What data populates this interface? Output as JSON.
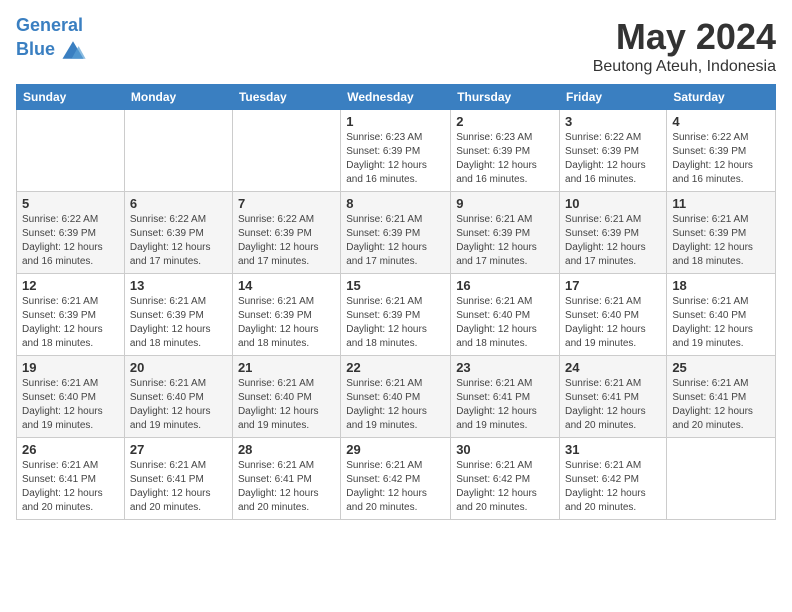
{
  "header": {
    "logo_line1": "General",
    "logo_line2": "Blue",
    "month_title": "May 2024",
    "location": "Beutong Ateuh, Indonesia"
  },
  "days_of_week": [
    "Sunday",
    "Monday",
    "Tuesday",
    "Wednesday",
    "Thursday",
    "Friday",
    "Saturday"
  ],
  "weeks": [
    [
      {
        "day": "",
        "info": ""
      },
      {
        "day": "",
        "info": ""
      },
      {
        "day": "",
        "info": ""
      },
      {
        "day": "1",
        "info": "Sunrise: 6:23 AM\nSunset: 6:39 PM\nDaylight: 12 hours and 16 minutes."
      },
      {
        "day": "2",
        "info": "Sunrise: 6:23 AM\nSunset: 6:39 PM\nDaylight: 12 hours and 16 minutes."
      },
      {
        "day": "3",
        "info": "Sunrise: 6:22 AM\nSunset: 6:39 PM\nDaylight: 12 hours and 16 minutes."
      },
      {
        "day": "4",
        "info": "Sunrise: 6:22 AM\nSunset: 6:39 PM\nDaylight: 12 hours and 16 minutes."
      }
    ],
    [
      {
        "day": "5",
        "info": "Sunrise: 6:22 AM\nSunset: 6:39 PM\nDaylight: 12 hours and 16 minutes."
      },
      {
        "day": "6",
        "info": "Sunrise: 6:22 AM\nSunset: 6:39 PM\nDaylight: 12 hours and 17 minutes."
      },
      {
        "day": "7",
        "info": "Sunrise: 6:22 AM\nSunset: 6:39 PM\nDaylight: 12 hours and 17 minutes."
      },
      {
        "day": "8",
        "info": "Sunrise: 6:21 AM\nSunset: 6:39 PM\nDaylight: 12 hours and 17 minutes."
      },
      {
        "day": "9",
        "info": "Sunrise: 6:21 AM\nSunset: 6:39 PM\nDaylight: 12 hours and 17 minutes."
      },
      {
        "day": "10",
        "info": "Sunrise: 6:21 AM\nSunset: 6:39 PM\nDaylight: 12 hours and 17 minutes."
      },
      {
        "day": "11",
        "info": "Sunrise: 6:21 AM\nSunset: 6:39 PM\nDaylight: 12 hours and 18 minutes."
      }
    ],
    [
      {
        "day": "12",
        "info": "Sunrise: 6:21 AM\nSunset: 6:39 PM\nDaylight: 12 hours and 18 minutes."
      },
      {
        "day": "13",
        "info": "Sunrise: 6:21 AM\nSunset: 6:39 PM\nDaylight: 12 hours and 18 minutes."
      },
      {
        "day": "14",
        "info": "Sunrise: 6:21 AM\nSunset: 6:39 PM\nDaylight: 12 hours and 18 minutes."
      },
      {
        "day": "15",
        "info": "Sunrise: 6:21 AM\nSunset: 6:39 PM\nDaylight: 12 hours and 18 minutes."
      },
      {
        "day": "16",
        "info": "Sunrise: 6:21 AM\nSunset: 6:40 PM\nDaylight: 12 hours and 18 minutes."
      },
      {
        "day": "17",
        "info": "Sunrise: 6:21 AM\nSunset: 6:40 PM\nDaylight: 12 hours and 19 minutes."
      },
      {
        "day": "18",
        "info": "Sunrise: 6:21 AM\nSunset: 6:40 PM\nDaylight: 12 hours and 19 minutes."
      }
    ],
    [
      {
        "day": "19",
        "info": "Sunrise: 6:21 AM\nSunset: 6:40 PM\nDaylight: 12 hours and 19 minutes."
      },
      {
        "day": "20",
        "info": "Sunrise: 6:21 AM\nSunset: 6:40 PM\nDaylight: 12 hours and 19 minutes."
      },
      {
        "day": "21",
        "info": "Sunrise: 6:21 AM\nSunset: 6:40 PM\nDaylight: 12 hours and 19 minutes."
      },
      {
        "day": "22",
        "info": "Sunrise: 6:21 AM\nSunset: 6:40 PM\nDaylight: 12 hours and 19 minutes."
      },
      {
        "day": "23",
        "info": "Sunrise: 6:21 AM\nSunset: 6:41 PM\nDaylight: 12 hours and 19 minutes."
      },
      {
        "day": "24",
        "info": "Sunrise: 6:21 AM\nSunset: 6:41 PM\nDaylight: 12 hours and 20 minutes."
      },
      {
        "day": "25",
        "info": "Sunrise: 6:21 AM\nSunset: 6:41 PM\nDaylight: 12 hours and 20 minutes."
      }
    ],
    [
      {
        "day": "26",
        "info": "Sunrise: 6:21 AM\nSunset: 6:41 PM\nDaylight: 12 hours and 20 minutes."
      },
      {
        "day": "27",
        "info": "Sunrise: 6:21 AM\nSunset: 6:41 PM\nDaylight: 12 hours and 20 minutes."
      },
      {
        "day": "28",
        "info": "Sunrise: 6:21 AM\nSunset: 6:41 PM\nDaylight: 12 hours and 20 minutes."
      },
      {
        "day": "29",
        "info": "Sunrise: 6:21 AM\nSunset: 6:42 PM\nDaylight: 12 hours and 20 minutes."
      },
      {
        "day": "30",
        "info": "Sunrise: 6:21 AM\nSunset: 6:42 PM\nDaylight: 12 hours and 20 minutes."
      },
      {
        "day": "31",
        "info": "Sunrise: 6:21 AM\nSunset: 6:42 PM\nDaylight: 12 hours and 20 minutes."
      },
      {
        "day": "",
        "info": ""
      }
    ]
  ]
}
